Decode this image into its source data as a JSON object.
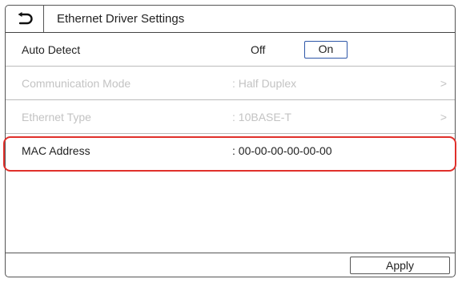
{
  "header": {
    "title": "Ethernet Driver Settings",
    "back_icon": "back-arrow-icon"
  },
  "rows": {
    "auto_detect": {
      "label": "Auto Detect",
      "off_label": "Off",
      "on_label": "On",
      "selected": "On"
    },
    "communication_mode": {
      "label": "Communication Mode",
      "value": ": Half Duplex",
      "chevron": ">",
      "enabled": false
    },
    "ethernet_type": {
      "label": "Ethernet Type",
      "value": ": 10BASE-T",
      "chevron": ">",
      "enabled": false
    },
    "mac_address": {
      "label": "MAC Address",
      "value": ":  00-00-00-00-00-00"
    }
  },
  "footer": {
    "apply_label": "Apply"
  },
  "colors": {
    "highlight": "#e0302b",
    "selected_border": "#2e57a8",
    "disabled_text": "#c3c3c3"
  }
}
